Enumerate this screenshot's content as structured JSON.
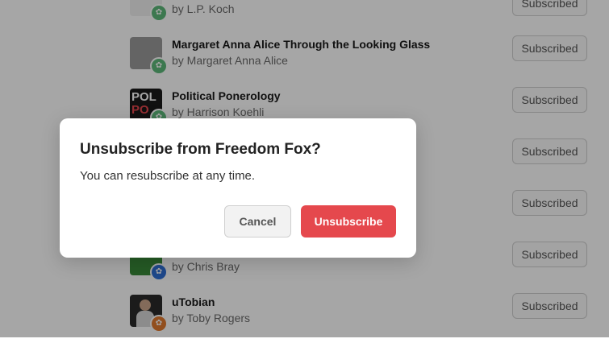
{
  "subscriptions": [
    {
      "title": "",
      "author": "by L.P. Koch",
      "button": "Subscribed",
      "badge_color": "#5cb87a",
      "thumb_color": "#f0f0f0"
    },
    {
      "title": "Margaret Anna Alice Through the Looking Glass",
      "author": "by Margaret Anna Alice",
      "button": "Subscribed",
      "badge_color": "#5cb87a",
      "thumb_color": "#8a8a8a"
    },
    {
      "title": "Political Ponerology",
      "author": "by Harrison Koehli",
      "button": "Subscribed",
      "badge_color": "#5cb87a",
      "thumb_color": "#1a1a1a",
      "thumb_text": "POL\nPO"
    },
    {
      "title": "",
      "author": "",
      "button": "Subscribed",
      "badge_color": "#5cb87a",
      "thumb_color": "#cccccc"
    },
    {
      "title": "",
      "author": "",
      "button": "Subscribed",
      "badge_color": "#5cb87a",
      "thumb_color": "#cccccc"
    },
    {
      "title": "",
      "author": "by Chris Bray",
      "button": "Subscribed",
      "badge_color": "#2f6fd6",
      "thumb_color": "#3a8a3a"
    },
    {
      "title": "uTobian",
      "author": "by Toby Rogers",
      "button": "Subscribed",
      "badge_color": "#e07a2e",
      "thumb_color": "#2a2a2a"
    }
  ],
  "modal": {
    "title": "Unsubscribe from Freedom Fox?",
    "body": "You can resubscribe at any time.",
    "cancel_label": "Cancel",
    "confirm_label": "Unsubscribe"
  },
  "colors": {
    "danger": "#e5484d",
    "overlay": "rgba(0,0,0,0.35)"
  },
  "icons": {
    "badge": "substack-badge-icon"
  }
}
